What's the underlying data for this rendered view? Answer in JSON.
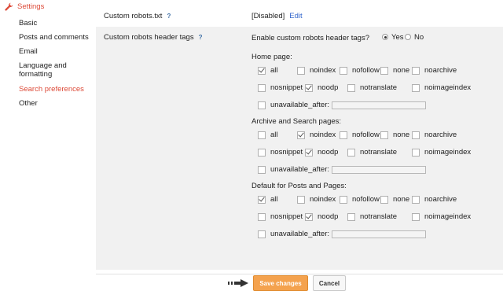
{
  "sidebar": {
    "header": "Settings",
    "items": [
      {
        "label": "Basic"
      },
      {
        "label": "Posts and comments"
      },
      {
        "label": "Email"
      },
      {
        "label": "Language and formatting"
      },
      {
        "label": "Search preferences",
        "active": true
      },
      {
        "label": "Other"
      }
    ]
  },
  "robots_txt": {
    "label": "Custom robots.txt",
    "help": "?",
    "status": "[Disabled]",
    "edit": "Edit"
  },
  "header_tags": {
    "label": "Custom robots header tags",
    "help": "?",
    "enable_question": "Enable custom robots header tags?",
    "yes": "Yes",
    "no": "No",
    "selected": "Yes"
  },
  "sections": [
    {
      "title": "Home page:",
      "tags": {
        "all": true,
        "noindex": false,
        "nofollow": false,
        "none": false,
        "noarchive": false,
        "nosnippet": false,
        "noodp": true,
        "notranslate": false,
        "noimageindex": false,
        "unavailable_after": false
      }
    },
    {
      "title": "Archive and Search pages:",
      "tags": {
        "all": false,
        "noindex": true,
        "nofollow": false,
        "none": false,
        "noarchive": false,
        "nosnippet": false,
        "noodp": true,
        "notranslate": false,
        "noimageindex": false,
        "unavailable_after": false
      }
    },
    {
      "title": "Default for Posts and Pages:",
      "tags": {
        "all": true,
        "noindex": false,
        "nofollow": false,
        "none": false,
        "noarchive": false,
        "nosnippet": false,
        "noodp": true,
        "notranslate": false,
        "noimageindex": false,
        "unavailable_after": false
      }
    }
  ],
  "tag_labels": {
    "all": "all",
    "noindex": "noindex",
    "nofollow": "nofollow",
    "none": "none",
    "noarchive": "noarchive",
    "nosnippet": "nosnippet",
    "noodp": "noodp",
    "notranslate": "notranslate",
    "noimageindex": "noimageindex",
    "unavailable_after": "unavailable_after:"
  },
  "buttons": {
    "save": "Save changes",
    "cancel": "Cancel"
  },
  "colors": {
    "accent": "#dd4b39",
    "link": "#3366cc",
    "save_button": "#f4a24e"
  },
  "icons": {
    "settings": "wrench-icon",
    "pointer": "arrow-right-icon"
  }
}
